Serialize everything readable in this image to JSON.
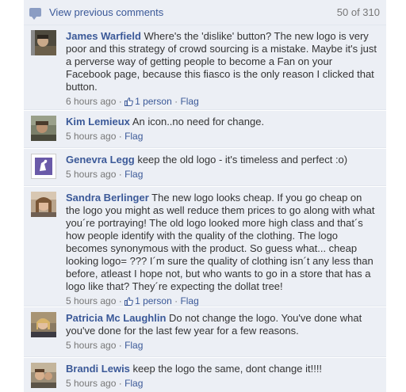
{
  "header": {
    "view_previous": "View previous comments",
    "count": "50 of 310"
  },
  "comments": [
    {
      "author": "James Warfield",
      "text": "Where's the 'dislike' button? The new logo is very poor and this strategy of crowd sourcing is a mistake. Maybe it's just a perverse way of getting people to become a Fan on your Facebook page, because this fiasco is the only reason I clicked that button.",
      "time": "6 hours ago",
      "likes": "1 person",
      "flag": "Flag"
    },
    {
      "author": "Kim Lemieux",
      "text": "An icon..no need for change.",
      "time": "5 hours ago",
      "flag": "Flag"
    },
    {
      "author": "Genevra Legg",
      "text": "keep the old logo - it's timeless and perfect :o)",
      "time": "5 hours ago",
      "flag": "Flag"
    },
    {
      "author": "Sandra Berlinger",
      "text": "The new logo looks cheap. If you go cheap on the logo you might as well reduce them prices to go along with what you´re portraying! The old logo looked more high class and that´s how people identify with the quality of the clothing. The logo becomes synonymous with the product. So guess what... cheap looking logo= ??? I´m sure the quality of clothing isn´t any less than before, atleast I hope not, but who wants to go in a store that has a logo like that? They´re expecting the dollat tree!",
      "time": "5 hours ago",
      "likes": "1 person",
      "flag": "Flag"
    },
    {
      "author": "Patricia Mc Laughlin",
      "text": "Do not change the logo. You've done what you've done for the last few year for a few reasons.",
      "time": "5 hours ago",
      "flag": "Flag"
    },
    {
      "author": "Brandi Lewis",
      "text": "keep the logo the same, dont change it!!!!",
      "time": "5 hours ago",
      "flag": "Flag"
    }
  ],
  "separator": " · ",
  "icons": {
    "comment": "comment-bubble-icon",
    "like": "thumbs-up-icon"
  },
  "colors": {
    "link": "#3b5998",
    "background": "#eceff5",
    "meta": "#777777"
  }
}
